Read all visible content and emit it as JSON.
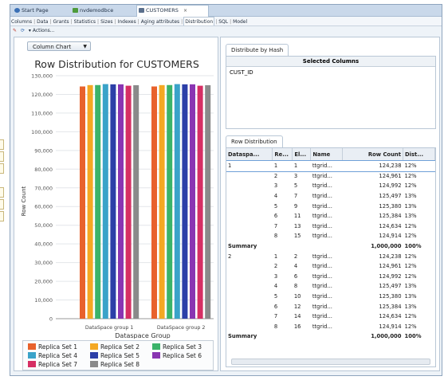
{
  "tabs": [
    {
      "label": "Start Page",
      "icon": "start-page-icon",
      "color": "#3a6fb5"
    },
    {
      "label": "nvdemodbce",
      "icon": "database-icon",
      "color": "#4d9a3a"
    },
    {
      "label": "CUSTOMERS",
      "icon": "table-icon",
      "color": "#5a6f8c"
    }
  ],
  "close_glyph": "×",
  "subtabs": [
    "Columns",
    "Data",
    "Grants",
    "Statistics",
    "Sizes",
    "Indexes",
    "Aging attributes",
    "Distribution",
    "SQL",
    "Model"
  ],
  "active_subtab": "Distribution",
  "toolbar": {
    "actions_label": "▾ Actions..."
  },
  "chart_selector": {
    "value": "Column Chart"
  },
  "chart_data": {
    "type": "bar",
    "title": "Row Distribution for CUSTOMERS",
    "xlabel": "Dataspace Group",
    "ylabel": "Row Count",
    "ylim": [
      0,
      130000
    ],
    "yticks": [
      "0",
      "10,000",
      "20,000",
      "30,000",
      "40,000",
      "50,000",
      "60,000",
      "70,000",
      "80,000",
      "90,000",
      "100,000",
      "110,000",
      "120,000",
      "130,000"
    ],
    "categories": [
      "DataSpace group 1",
      "DataSpace group 2"
    ],
    "series": [
      {
        "name": "Replica Set 1",
        "color": "#e8622c",
        "values": [
          124238,
          124238
        ]
      },
      {
        "name": "Replica Set 2",
        "color": "#f4a823",
        "values": [
          124961,
          124961
        ]
      },
      {
        "name": "Replica Set 3",
        "color": "#3bb36a",
        "values": [
          124992,
          124992
        ]
      },
      {
        "name": "Replica Set 4",
        "color": "#3aa3c9",
        "values": [
          125497,
          125497
        ]
      },
      {
        "name": "Replica Set 5",
        "color": "#2c3fa8",
        "values": [
          125380,
          125380
        ]
      },
      {
        "name": "Replica Set 6",
        "color": "#8a35b2",
        "values": [
          125384,
          125384
        ]
      },
      {
        "name": "Replica Set 7",
        "color": "#d62f64",
        "values": [
          124634,
          124634
        ]
      },
      {
        "name": "Replica Set 8",
        "color": "#8a8a8a",
        "values": [
          124914,
          124914
        ]
      }
    ],
    "grid": true,
    "legend": "bottom"
  },
  "distribute": {
    "tab_label": "Distribute by Hash",
    "header": "Selected Columns",
    "columns": [
      "CUST_ID"
    ]
  },
  "row_dist": {
    "tab_label": "Row Distribution",
    "headers": [
      "Dataspa...",
      "Re...",
      "El...",
      "Name",
      "Row Count",
      "Dist..."
    ],
    "groups": [
      {
        "dataspace": "1",
        "rows": [
          {
            "re": "1",
            "el": "1",
            "name": "ttgrid...",
            "count": "124,238",
            "dist": "12%"
          },
          {
            "re": "2",
            "el": "3",
            "name": "ttgrid...",
            "count": "124,961",
            "dist": "12%"
          },
          {
            "re": "3",
            "el": "5",
            "name": "ttgrid...",
            "count": "124,992",
            "dist": "12%"
          },
          {
            "re": "4",
            "el": "7",
            "name": "ttgrid...",
            "count": "125,497",
            "dist": "13%"
          },
          {
            "re": "5",
            "el": "9",
            "name": "ttgrid...",
            "count": "125,380",
            "dist": "13%"
          },
          {
            "re": "6",
            "el": "11",
            "name": "ttgrid...",
            "count": "125,384",
            "dist": "13%"
          },
          {
            "re": "7",
            "el": "13",
            "name": "ttgrid...",
            "count": "124,634",
            "dist": "12%"
          },
          {
            "re": "8",
            "el": "15",
            "name": "ttgrid...",
            "count": "124,914",
            "dist": "12%"
          }
        ],
        "summary": {
          "label": "Summary",
          "count": "1,000,000",
          "dist": "100%"
        }
      },
      {
        "dataspace": "2",
        "rows": [
          {
            "re": "1",
            "el": "2",
            "name": "ttgrid...",
            "count": "124,238",
            "dist": "12%"
          },
          {
            "re": "2",
            "el": "4",
            "name": "ttgrid...",
            "count": "124,961",
            "dist": "12%"
          },
          {
            "re": "3",
            "el": "6",
            "name": "ttgrid...",
            "count": "124,992",
            "dist": "12%"
          },
          {
            "re": "4",
            "el": "8",
            "name": "ttgrid...",
            "count": "125,497",
            "dist": "13%"
          },
          {
            "re": "5",
            "el": "10",
            "name": "ttgrid...",
            "count": "125,380",
            "dist": "13%"
          },
          {
            "re": "6",
            "el": "12",
            "name": "ttgrid...",
            "count": "125,384",
            "dist": "13%"
          },
          {
            "re": "7",
            "el": "14",
            "name": "ttgrid...",
            "count": "124,634",
            "dist": "12%"
          },
          {
            "re": "8",
            "el": "16",
            "name": "ttgrid...",
            "count": "124,914",
            "dist": "12%"
          }
        ],
        "summary": {
          "label": "Summary",
          "count": "1,000,000",
          "dist": "100%"
        }
      }
    ]
  }
}
